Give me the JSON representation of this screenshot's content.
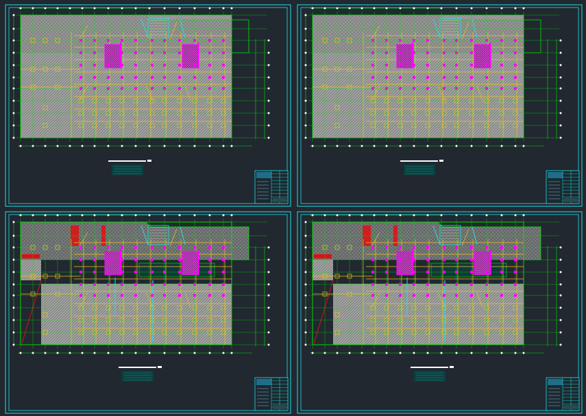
{
  "drawing": {
    "background": "#212830",
    "colors": {
      "frame": "#22e0e8",
      "grid": "#00e600",
      "column": "#ff00ff",
      "beam": "#f0c020",
      "slab": "#8a8a8a",
      "hatch": "#c8c8c8",
      "node": "#ffffff",
      "wall": "#e01010",
      "label": "#ffffff",
      "titleblock_fill": "#0b4040"
    },
    "sheets": [
      {
        "id": "sheet-1",
        "variant": "a"
      },
      {
        "id": "sheet-2",
        "variant": "a"
      },
      {
        "id": "sheet-3",
        "variant": "b"
      },
      {
        "id": "sheet-4",
        "variant": "b"
      }
    ]
  }
}
